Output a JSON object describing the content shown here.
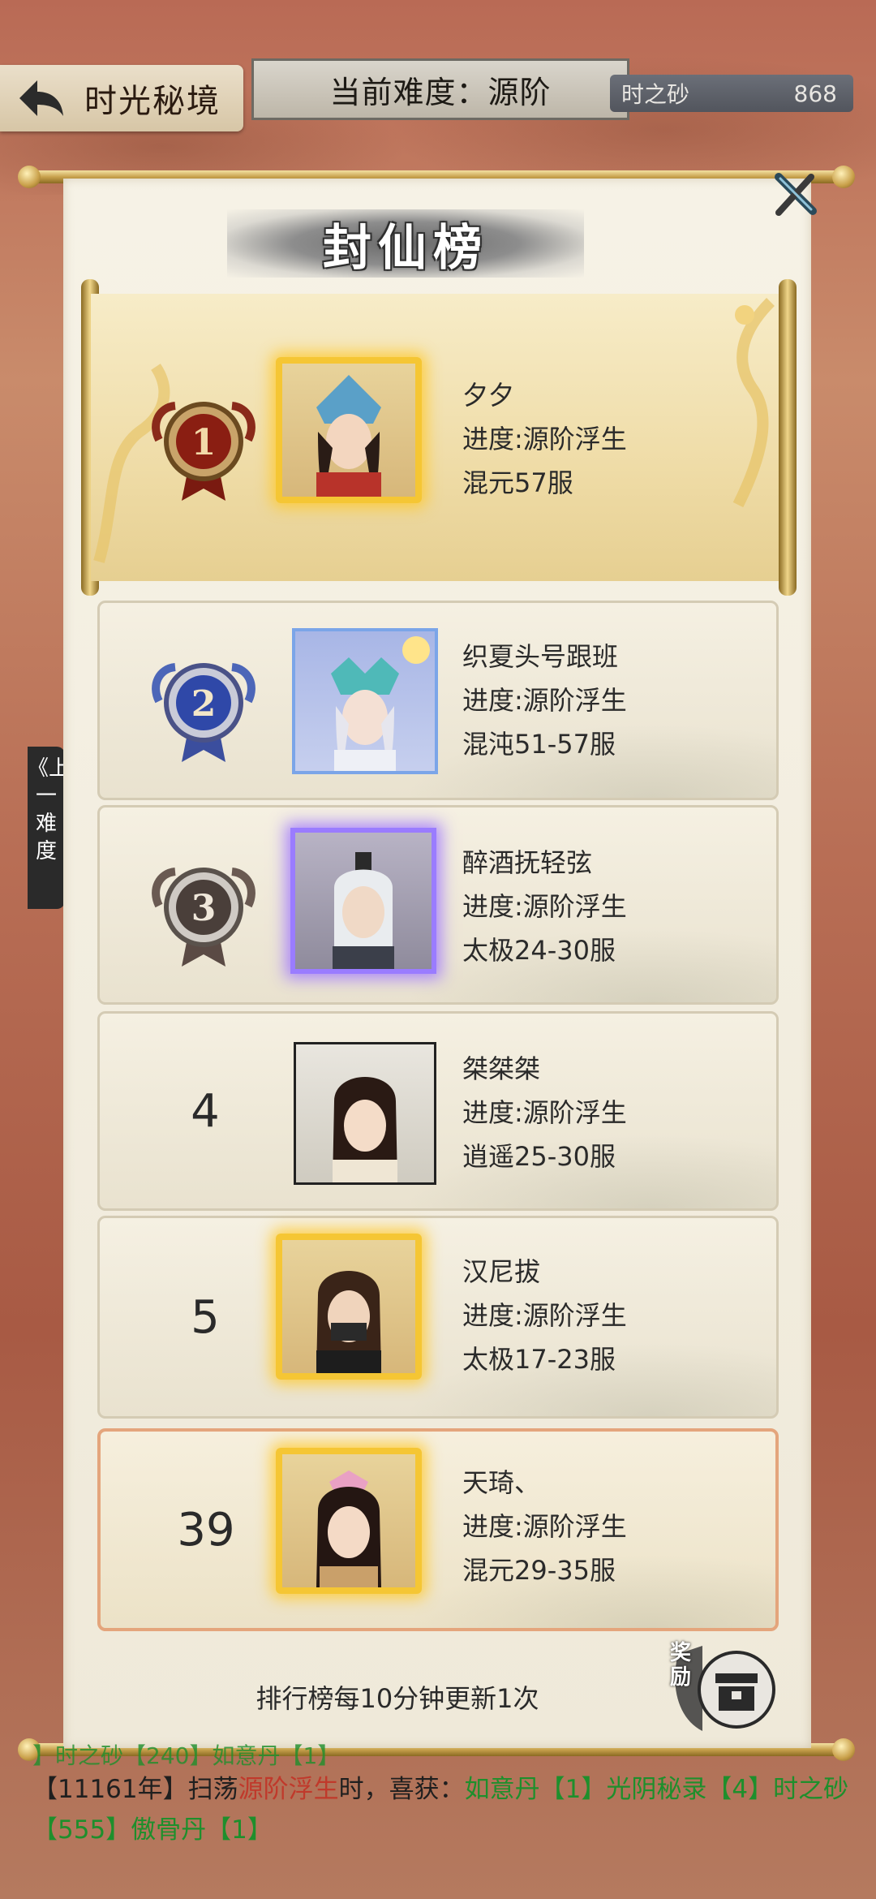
{
  "header": {
    "back_label": "时光秘境",
    "difficulty": "当前难度：源阶",
    "currency_name": "时之砂",
    "currency_value": "868"
  },
  "side_tab": "《上一难度",
  "panel": {
    "title": "封仙榜",
    "notice": "排行榜每10分钟更新1次",
    "reward_label": "奖励"
  },
  "leaderboard": [
    {
      "rank": "1",
      "name": "夕夕",
      "progress": "进度:源阶浮生",
      "server": "混元57服"
    },
    {
      "rank": "2",
      "name": "织夏头号跟班",
      "progress": "进度:源阶浮生",
      "server": "混沌51-57服"
    },
    {
      "rank": "3",
      "name": "醉酒抚轻弦",
      "progress": "进度:源阶浮生",
      "server": "太极24-30服"
    },
    {
      "rank": "4",
      "name": "桀桀桀",
      "progress": "进度:源阶浮生",
      "server": "逍遥25-30服"
    },
    {
      "rank": "5",
      "name": "汉尼拔",
      "progress": "进度:源阶浮生",
      "server": "太极17-23服"
    }
  ],
  "my_rank": {
    "rank": "39",
    "name": "天琦、",
    "progress": "进度:源阶浮生",
    "server": "混元29-35服"
  },
  "log": {
    "prev_line": "】时之砂【240】如意丹【1】",
    "year": "【11161年】扫荡",
    "stage": "源阶浮生",
    "mid": "时，喜获：",
    "items": "如意丹【1】光阴秘录【4】时之砂【555】傲骨丹【1】"
  },
  "colors": {
    "gold_frame": "#f5c634",
    "purple_frame": "#9a7cff",
    "highlight_red": "#c0392b",
    "highlight_green": "#1e8f2c"
  }
}
